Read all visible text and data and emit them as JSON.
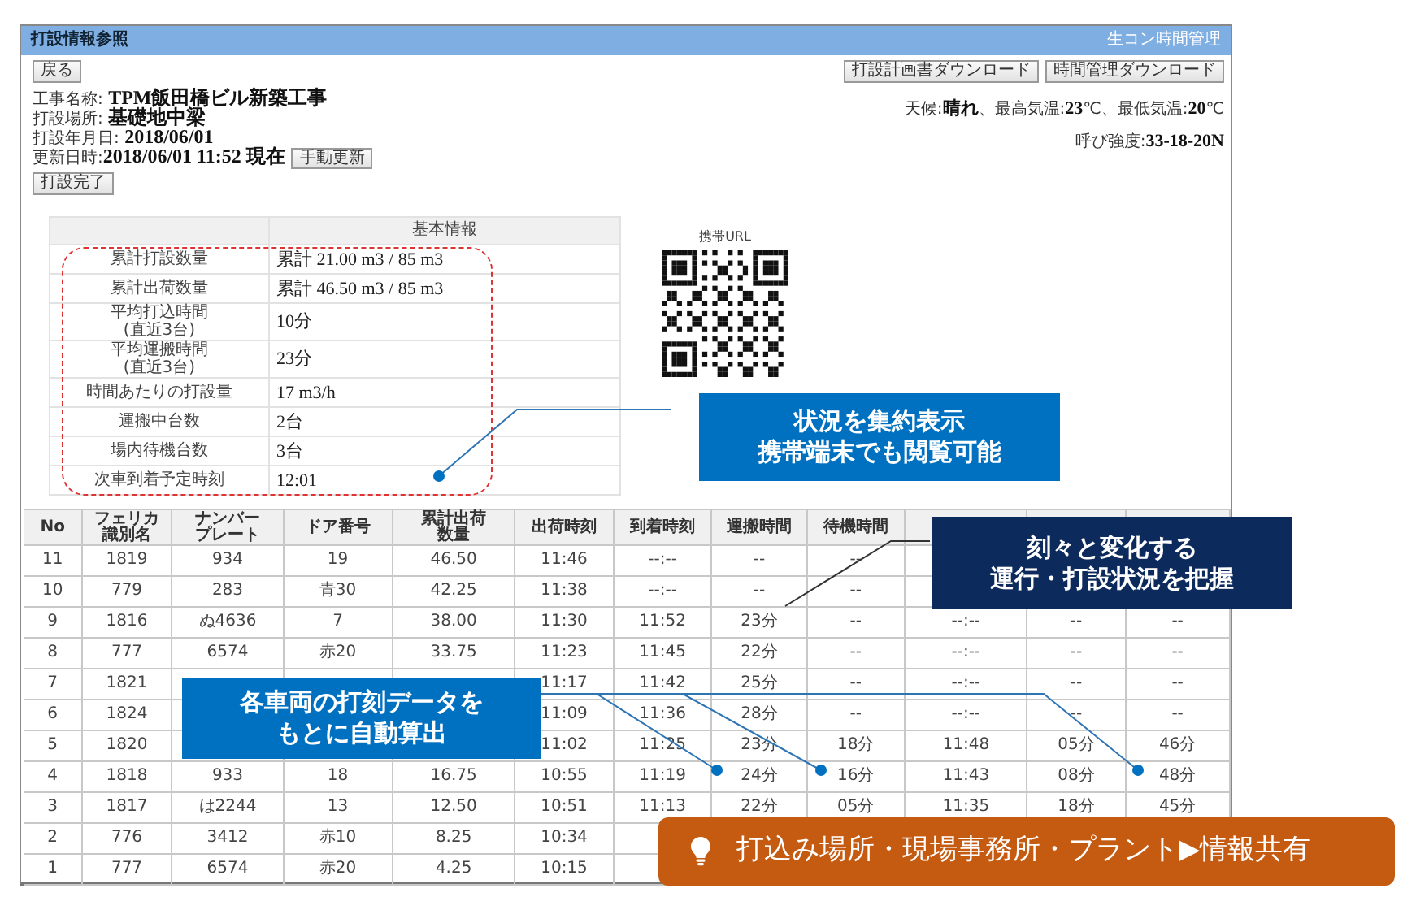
{
  "window": {
    "title": "打設情報参照",
    "app_name": "生コン時間管理"
  },
  "back_button": "戻る",
  "download_buttons": [
    "打設計画書ダウンロード",
    "時間管理ダウンロード"
  ],
  "project_lines": [
    "工事名称: **TPM飯田橋ビル新築工事**",
    "打設場所: **基礎地中梁**",
    "打設年月日: **2018/06/01**",
    "更新日時:**2018/06/01 11:52 現在**"
  ],
  "refresh_button": "手動更新",
  "weather": "天候:**晴れ**、最高気温:**23**℃、最低気温:**20**℃",
  "strength": "呼び強度:**33-18-20N**",
  "complete_button": "打設完了",
  "basic_info": {
    "title": "基本情報",
    "rows": [
      {
        "label": "累計打設数量",
        "value": "累計 21.00 m3 / 85 m3"
      },
      {
        "label": "累計出荷数量",
        "value": "累計 46.50 m3 / 85 m3"
      },
      {
        "label": "平均打込時間\n(直近3台)",
        "value": "10分"
      },
      {
        "label": "平均運搬時間\n(直近3台)",
        "value": "23分"
      },
      {
        "label": "時間あたりの打設量",
        "value": "17 m3/h"
      },
      {
        "label": "運搬中台数",
        "value": "2台"
      },
      {
        "label": "場内待機台数",
        "value": "3台"
      },
      {
        "label": "次車到着予定時刻",
        "value": "12:01"
      }
    ]
  },
  "qr": {
    "label": "携帯URL"
  },
  "table": {
    "columns": [
      "No",
      "フェリカ識別名",
      "ナンバープレート",
      "ドア番号",
      "累計出荷数量",
      "出荷時刻",
      "到着時刻",
      "運搬時間",
      "待機時間",
      null,
      null,
      null
    ],
    "rows": [
      [
        "11",
        "1819",
        "934",
        "19",
        "46.50",
        "11:46",
        "--:--",
        "--",
        "--",
        null,
        null,
        null
      ],
      [
        "10",
        "779",
        "283",
        "青30",
        "42.25",
        "11:38",
        "--:--",
        "--",
        "--",
        null,
        null,
        null
      ],
      [
        "9",
        "1816",
        "ぬ4636",
        "7",
        "38.00",
        "11:30",
        "11:52",
        "23分",
        "--",
        "--:--",
        "--",
        "--"
      ],
      [
        "8",
        "777",
        "6574",
        "赤20",
        "33.75",
        "11:23",
        "11:45",
        "22分",
        "--",
        "--:--",
        "--",
        "--"
      ],
      [
        "7",
        "1821",
        null,
        null,
        null,
        "11:17",
        "11:42",
        "25分",
        "--",
        "--:--",
        "--",
        "--"
      ],
      [
        "6",
        "1824",
        null,
        null,
        null,
        "11:09",
        "11:36",
        "28分",
        "--",
        "--:--",
        "--",
        "--"
      ],
      [
        "5",
        "1820",
        null,
        null,
        null,
        "11:02",
        "11:25",
        "23分",
        "18分",
        "11:48",
        "05分",
        "46分"
      ],
      [
        "4",
        "1818",
        "933",
        "18",
        "16.75",
        "10:55",
        "11:19",
        "24分",
        "16分",
        "11:43",
        "08分",
        "48分"
      ],
      [
        "3",
        "1817",
        "は2244",
        "13",
        "12.50",
        "10:51",
        "11:13",
        "22分",
        "05分",
        "11:35",
        "18分",
        "45分"
      ],
      [
        "2",
        "776",
        "3412",
        "赤10",
        "8.25",
        "10:34",
        null,
        null,
        null,
        null,
        null,
        null
      ],
      [
        "1",
        "777",
        "6574",
        "赤20",
        "4.25",
        "10:15",
        null,
        null,
        null,
        null,
        null,
        null
      ]
    ]
  },
  "callouts": [
    {
      "kind": "summary",
      "lines": [
        "状況を集約表示",
        "携帯端末でも閲覧可能"
      ]
    },
    {
      "kind": "change",
      "lines": [
        "刻々と変化する",
        "運行・打設状況を把握"
      ]
    },
    {
      "kind": "calc",
      "lines": [
        "各車両の打刻データを",
        "もとに自動算出"
      ]
    },
    {
      "kind": "share",
      "lines": [
        "打込み場所・現場事務所・プラント▶情報共有"
      ]
    }
  ]
}
